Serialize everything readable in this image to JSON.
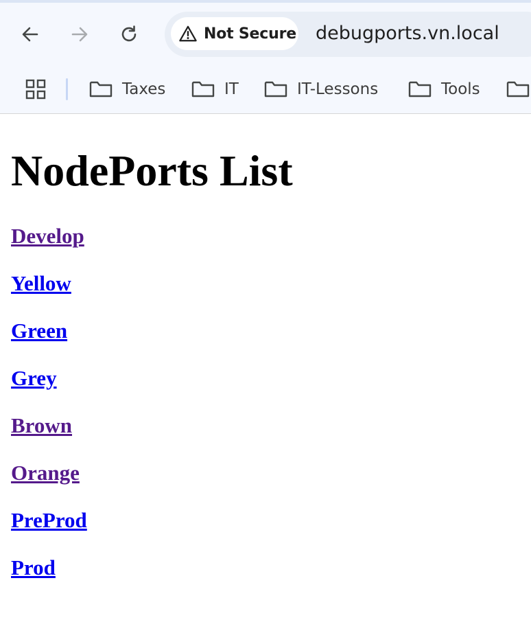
{
  "browser": {
    "security_label": "Not Secure",
    "url": "debugports.vn.local",
    "bookmarks": [
      {
        "label": "Taxes"
      },
      {
        "label": "IT"
      },
      {
        "label": "IT-Lessons"
      },
      {
        "label": "Tools"
      },
      {
        "label": ""
      }
    ]
  },
  "page": {
    "title": "NodePorts List",
    "links": [
      {
        "label": "Develop",
        "visited": true
      },
      {
        "label": "Yellow",
        "visited": false
      },
      {
        "label": "Green",
        "visited": false
      },
      {
        "label": "Grey",
        "visited": false
      },
      {
        "label": "Brown",
        "visited": true
      },
      {
        "label": "Orange",
        "visited": true
      },
      {
        "label": "PreProd",
        "visited": false
      },
      {
        "label": "Prod",
        "visited": false
      }
    ]
  },
  "colors": {
    "visited_link": "#551a8b",
    "unvisited_link": "#0000ee",
    "toolbar_bg": "#f5f8fe",
    "omnibox_bg": "#e9eef6"
  }
}
